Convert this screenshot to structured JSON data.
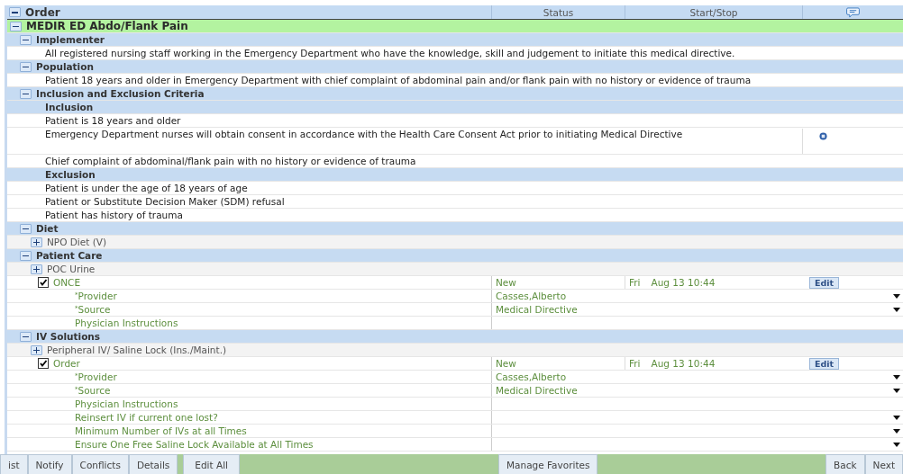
{
  "table": {
    "columns": [
      {
        "label": "Order",
        "expanded": true
      },
      {
        "label": "Status"
      },
      {
        "label": "Start/Stop"
      },
      {
        "kind": "comment"
      }
    ],
    "rows": [
      {
        "kind": "plan",
        "label": "MEDIR ED Abdo/Flank Pain",
        "expanded": true,
        "children": [
          {
            "kind": "section",
            "label": "Implementer",
            "expanded": true,
            "children": [
              {
                "kind": "text",
                "label": "All registered nursing staff working in the Emergency Department who have the knowledge, skill and judgement to initiate this medical directive."
              }
            ]
          },
          {
            "kind": "section",
            "label": "Population",
            "expanded": true,
            "children": [
              {
                "kind": "text",
                "label": "Patient 18 years and older in Emergency Department with chief complaint of abdominal pain and/or flank pain with no history or evidence of trauma"
              }
            ]
          },
          {
            "kind": "section",
            "label": "Inclusion and Exclusion Criteria",
            "expanded": true,
            "children": [
              {
                "kind": "subheader",
                "label": "Inclusion"
              },
              {
                "kind": "text",
                "label": "Patient is 18 years and older"
              },
              {
                "kind": "text",
                "label": "Emergency Department  nurses will obtain consent in accordance with the Health Care Consent Act prior to initiating Medical Directive",
                "note": true
              },
              {
                "kind": "text",
                "label": "Chief complaint of abdominal/flank pain with no history or evidence of trauma"
              },
              {
                "kind": "subheader",
                "label": "Exclusion"
              },
              {
                "kind": "text",
                "label": "Patient is under the age of 18 years of age"
              },
              {
                "kind": "text",
                "label": "Patient or Substitute Decision Maker (SDM) refusal"
              },
              {
                "kind": "text",
                "label": "Patient has history of trauma"
              }
            ]
          },
          {
            "kind": "section",
            "label": "Diet",
            "expanded": true,
            "children": [
              {
                "kind": "orderable",
                "label": "NPO Diet (V)",
                "expanded": false
              }
            ]
          },
          {
            "kind": "section",
            "label": "Patient Care",
            "expanded": true,
            "children": [
              {
                "kind": "orderable",
                "label": "POC Urine",
                "expanded": false
              },
              {
                "kind": "order",
                "label": "ONCE",
                "checked": true,
                "status": "New",
                "day": "Fri",
                "datetime": "Aug 13 10:44",
                "button": "Edit",
                "children": [
                  {
                    "kind": "detail",
                    "label": "$^{*}$Provider",
                    "value": "Casses,Alberto",
                    "dropdown": true
                  },
                  {
                    "kind": "detail",
                    "label": "$^{*}$Source",
                    "value": "Medical Directive",
                    "dropdown": true
                  },
                  {
                    "kind": "detail",
                    "label": "Physician Instructions",
                    "dropdown": false
                  }
                ]
              }
            ]
          },
          {
            "kind": "section",
            "label": "IV Solutions",
            "expanded": true,
            "children": [
              {
                "kind": "orderable",
                "label": "Peripheral IV/ Saline Lock (Ins./Maint.)",
                "expanded": false
              },
              {
                "kind": "order",
                "label": "Order",
                "checked": true,
                "status": "New",
                "day": "Fri",
                "datetime": "Aug 13 10:44",
                "button": "Edit",
                "children": [
                  {
                    "kind": "detail",
                    "label": "$^{*}$Provider",
                    "value": "Casses,Alberto",
                    "dropdown": true
                  },
                  {
                    "kind": "detail",
                    "label": "$^{*}$Source",
                    "value": "Medical Directive",
                    "dropdown": true
                  },
                  {
                    "kind": "detail",
                    "label": "Physician Instructions",
                    "dropdown": false
                  },
                  {
                    "kind": "detail",
                    "label": "Reinsert IV if current one lost?",
                    "dropdown": true
                  },
                  {
                    "kind": "detail",
                    "label": "Minimum Number of IVs at all Times",
                    "dropdown": true
                  },
                  {
                    "kind": "detail",
                    "label": "Ensure One Free Saline Lock Available at All Times",
                    "dropdown": true
                  }
                ]
              }
            ]
          }
        ]
      }
    ]
  },
  "footer": {
    "tabs": [
      "ist",
      "Notify",
      "Conflicts",
      "Details"
    ],
    "edit_all": "Edit All",
    "manage": "Manage Favorites",
    "nav": [
      "Back",
      "Next"
    ]
  }
}
